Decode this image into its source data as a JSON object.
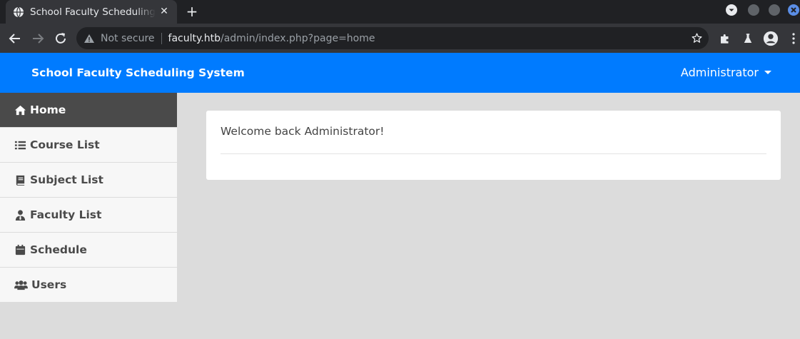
{
  "browser": {
    "tab_title": "School Faculty Scheduling System",
    "close_symbol": "✕",
    "new_tab_symbol": "+",
    "omnibox": {
      "security_label": "Not secure",
      "url_host": "faculty.htb",
      "url_path": "/admin/index.php?page=home"
    }
  },
  "app": {
    "brand": "School Faculty Scheduling System",
    "user_menu_label": "Administrator",
    "accent_color": "#007bff"
  },
  "sidebar": {
    "items": [
      {
        "label": "Home",
        "icon": "home-icon"
      },
      {
        "label": "Course List",
        "icon": "list-icon"
      },
      {
        "label": "Subject List",
        "icon": "book-icon"
      },
      {
        "label": "Faculty List",
        "icon": "user-tie-icon"
      },
      {
        "label": "Schedule",
        "icon": "calendar-icon"
      },
      {
        "label": "Users",
        "icon": "users-icon"
      }
    ]
  },
  "main": {
    "welcome_text": "Welcome back Administrator!"
  }
}
